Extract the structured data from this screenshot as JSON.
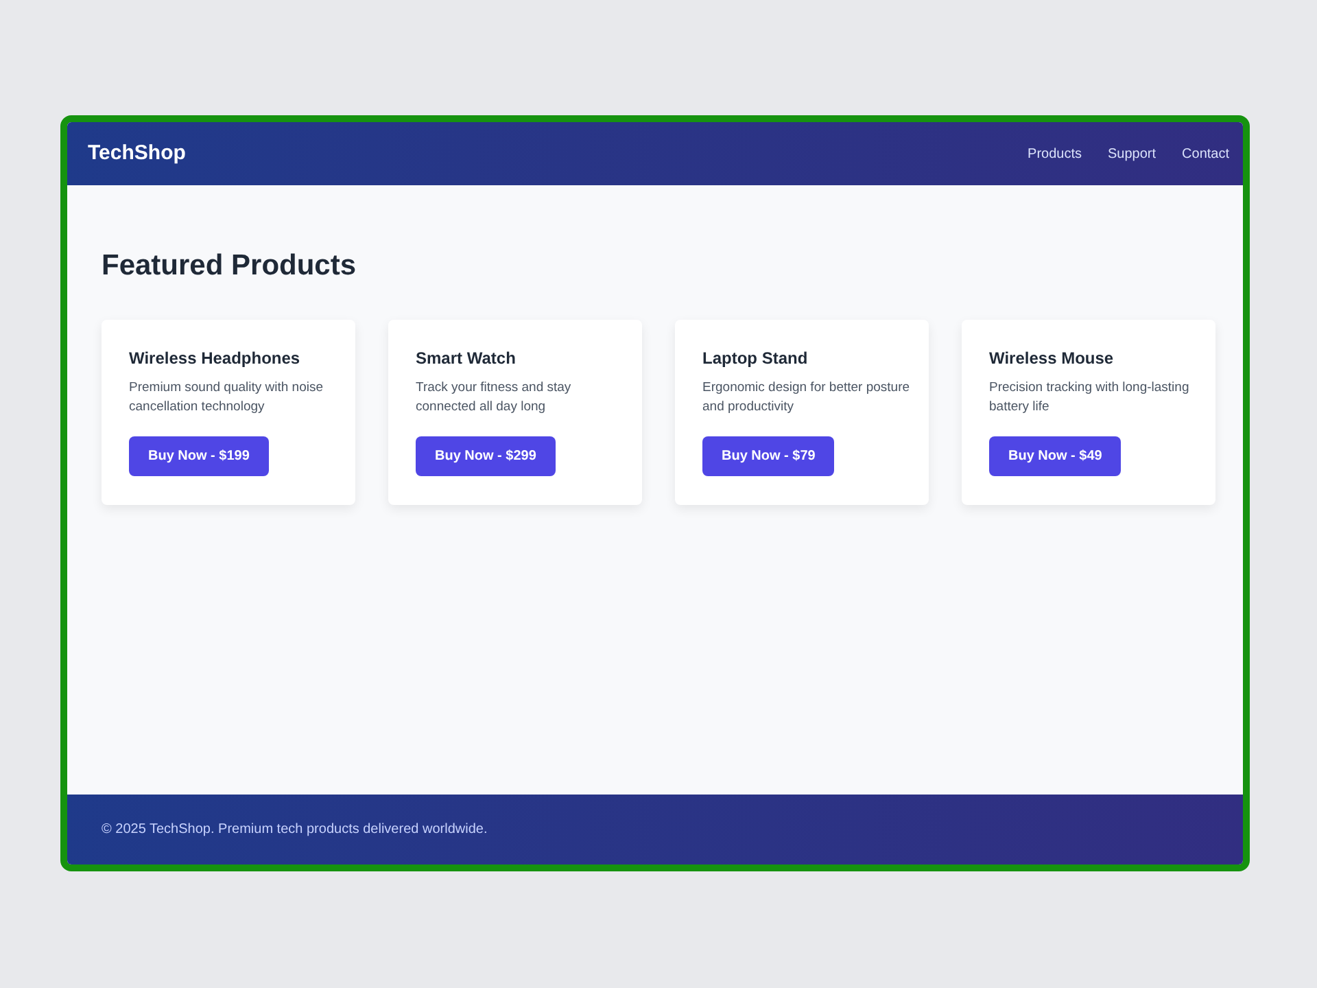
{
  "header": {
    "logo": "TechShop",
    "nav": [
      "Products",
      "Support",
      "Contact"
    ]
  },
  "main": {
    "heading": "Featured Products",
    "products": [
      {
        "name": "Wireless Headphones",
        "description": "Premium sound quality with noise cancellation technology",
        "button": "Buy Now - $199"
      },
      {
        "name": "Smart Watch",
        "description": "Track your fitness and stay connected all day long",
        "button": "Buy Now - $299"
      },
      {
        "name": "Laptop Stand",
        "description": "Ergonomic design for better posture and productivity",
        "button": "Buy Now - $79"
      },
      {
        "name": "Wireless Mouse",
        "description": "Precision tracking with long-lasting battery life",
        "button": "Buy Now - $49"
      }
    ]
  },
  "footer": {
    "text": "© 2025 TechShop. Premium tech products delivered worldwide."
  }
}
